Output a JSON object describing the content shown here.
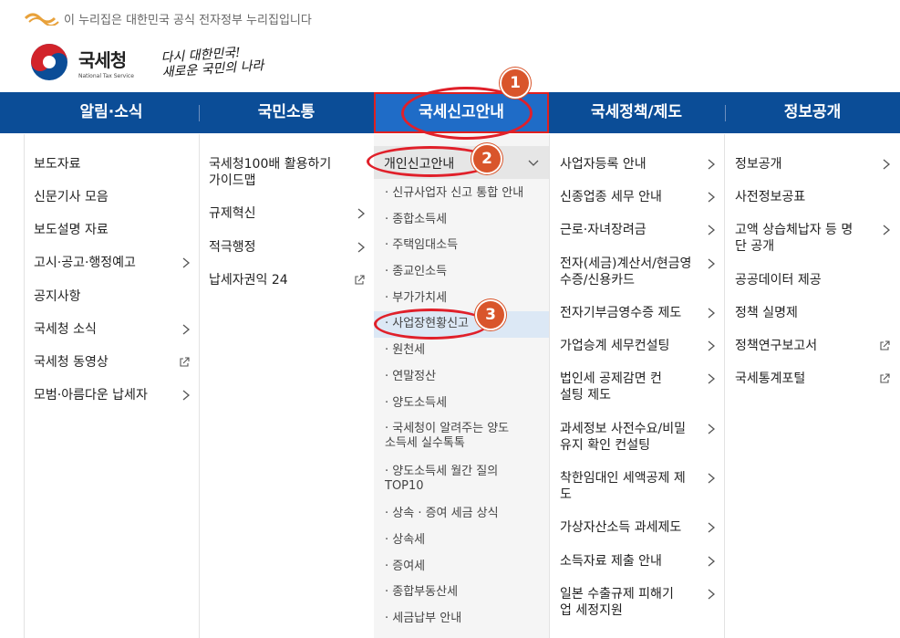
{
  "gov_banner": {
    "text": "이 누리집은 대한민국 공식 전자정부 누리집입니다",
    "logo_icon": "egov-logo-icon"
  },
  "brand": {
    "name_ko": "국세청",
    "name_en": "National Tax Service",
    "slogan_line1": "다시 대한민국!",
    "slogan_line2": "새로운 국민의 나라"
  },
  "gnb": {
    "items": [
      "알림·소식",
      "국민소통",
      "국세신고안내",
      "국세정책/제도",
      "정보공개"
    ],
    "active_index": 2
  },
  "col1": [
    "보도자료",
    "신문기사 모음",
    "보도설명 자료",
    "고시·공고·행정예고",
    "공지사항",
    "국세청 소식",
    "국세청 동영상",
    "모범·아름다운 납세자"
  ],
  "col2": [
    "국세청100배 활용하기 가이드맵",
    "규제혁신",
    "적극행정",
    "납세자권익 24"
  ],
  "col3": {
    "header": "개인신고안내",
    "items": [
      "신규사업자 신고 통합 안내",
      "종합소득세",
      "주택임대소득",
      "종교인소득",
      "부가가치세",
      "사업장현황신고",
      "원천세",
      "연말정산",
      "양도소득세",
      "국세청이 알려주는 양도소득세 실수톡톡",
      "양도소득세 월간 질의 TOP10",
      "상속 · 증여 세금 상식",
      "상속세",
      "증여세",
      "종합부동산세",
      "세금납부 안내"
    ]
  },
  "col4": [
    "사업자등록 안내",
    "신종업종 세무 안내",
    "근로·자녀장려금",
    "전자(세금)계산서/현금영수증/신용카드",
    "전자기부금영수증 제도",
    "가업승계 세무컨설팅",
    "법인세 공제감면 컨설팅 제도",
    "과세정보 사전수요/비밀유지 확인 컨설팅",
    "착한임대인 세액공제 제도",
    "가상자산소득 과세제도",
    "소득자료 제출 안내",
    "일본 수출규제 피해기업 세정지원"
  ],
  "col5": [
    "정보공개",
    "사전정보공표",
    "고액 상습체납자 등 명단 공개",
    "공공데이터 제공",
    "정책 실명제",
    "정책연구보고서",
    "국세통계포털"
  ],
  "annotations": {
    "badge1": "1",
    "badge2": "2",
    "badge3": "3"
  },
  "colors": {
    "gnb_bg": "#0b4d97",
    "gnb_active": "#1f6cc7",
    "badge": "#d9552b",
    "highlight": "#e0202a"
  }
}
